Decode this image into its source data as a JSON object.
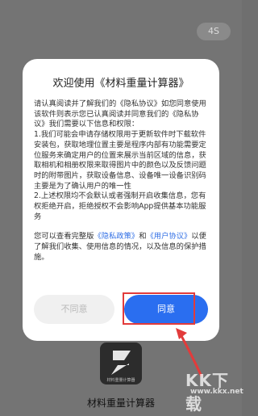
{
  "background": {
    "badge": "4S"
  },
  "dialog": {
    "title": "欢迎使用《材料重量计算器》",
    "para1": "请认真阅读并了解我们的《隐私协议》如您同意使用该软件则表示您已认真阅读并同意我们的《隐私协议》我们需要以下信息和权限：",
    "para2": "1.我们可能会申请存储权限用于更新软件时下载软件安装包，获取地理位置主要是程序内部有功能需要定位服务来确定用户的位置来展示当前区域的信息，获取相机和相册权限来取得图片中的颜色以及反馈问题时的附带图片，获取设备信息、设备唯一设备识别码主要是为了确认用户的唯一性",
    "para3": "2.上述权限均不会默认或者强制开启收集信息，您有权拒绝开启，拒绝授权不会影响App提供基本功能服务",
    "para4_prefix": "您可以查看完整版",
    "privacy_policy_link": "《隐私政策》",
    "para4_and": "和",
    "user_agreement_link": "《用户协议》",
    "para4_suffix": "以便了解我们收集、使用信息的情况，以及信息的保护措施。",
    "decline_label": "不同意",
    "accept_label": "同意"
  },
  "app": {
    "name": "材料重量计算器",
    "icon_caption": "材料重量计算器",
    "icon": "app-logo-icon"
  },
  "watermark": {
    "text": "KK下载",
    "url": "www.kkx.net"
  },
  "colors": {
    "accent": "#2a6ef0",
    "link": "#2f6ee5",
    "highlight": "#e23b3b",
    "overlay": "#747474"
  }
}
